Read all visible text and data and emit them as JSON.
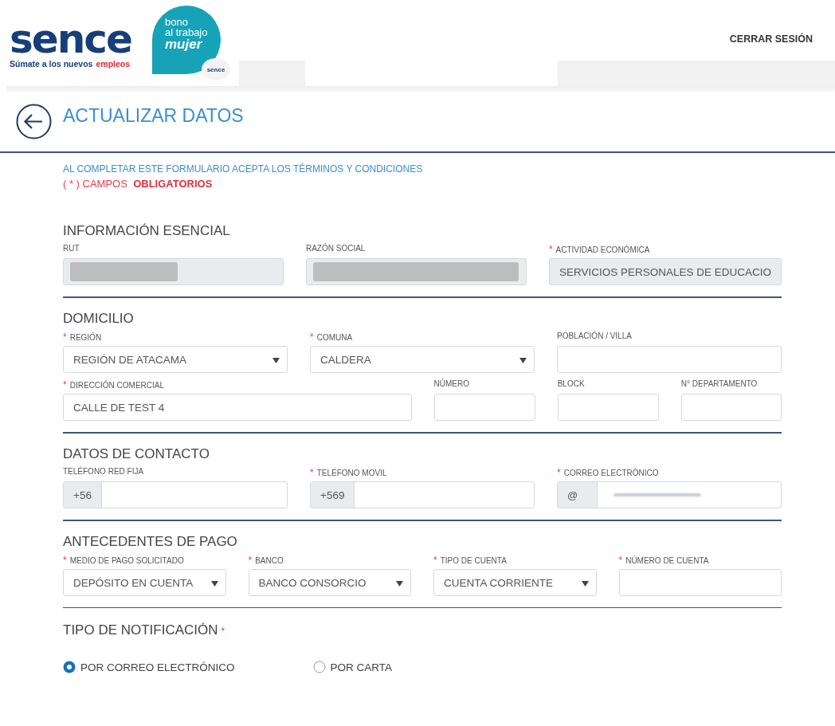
{
  "header": {
    "logo": {
      "wordmark": "sence",
      "tagline": "Súmate a los nuevos",
      "tagline_highlight": "empleos"
    },
    "badge": {
      "lines": [
        "bono",
        "al trabajo"
      ],
      "emphasis": "mujer",
      "mini_logo": "sence"
    },
    "logout": "CERRAR SESIÓN"
  },
  "page_title": "ACTUALIZAR DATOS",
  "notice": "AL COMPLETAR ESTE FORMULARIO ACEPTA LOS TÉRMINOS Y CONDICIONES",
  "required_note": "( * ) CAMPOS  **OBLIGATORIOS**",
  "sections": [
    {
      "title": "INFORMACIÓN ESENCIAL",
      "rows": [
        {
          "fields": [
            {
              "label": "RUT",
              "kind": "readonly",
              "redacted": true
            },
            {
              "label": "RAZÓN SOCIAL",
              "kind": "readonly",
              "redacted": true
            },
            {
              "label": "ACTIVIDAD ECONÓMICA",
              "mark": "*",
              "kind": "readonly",
              "value": "SERVICIOS PERSONALES DE EDUCACIO"
            }
          ]
        }
      ]
    },
    {
      "title": "DOMICILIO",
      "rows": [
        {
          "fields": [
            {
              "label": "REGIÓN",
              "mark": "*",
              "kind": "select",
              "value": "REGIÓN DE ATACAMA"
            },
            {
              "label": "COMUNA",
              "mark": "*",
              "kind": "select",
              "value": "CALDERA"
            },
            {
              "label": "POBLACIÓN / VILLA",
              "kind": "text"
            }
          ]
        },
        {
          "fields": [
            {
              "label": "DIRECCIÓN COMERCIAL",
              "mark": "*",
              "kind": "text",
              "value": "CALLE DE TEST 4"
            },
            {
              "label": "NÚMERO",
              "kind": "text"
            },
            {
              "label": "BLOCK",
              "kind": "text"
            },
            {
              "label": "N° DEPARTAMENTO",
              "kind": "text"
            }
          ]
        }
      ]
    },
    {
      "title": "DATOS DE CONTACTO",
      "rows": [
        {
          "fields": [
            {
              "label": "TELÉFONO RED FIJA",
              "kind": "prefixed",
              "prefix": "+56"
            },
            {
              "label": "TELÉFONO MOVIL",
              "mark": "*",
              "kind": "prefixed",
              "prefix": "+569"
            },
            {
              "label": "CORREO ELECTRÓNICO",
              "mark": "*",
              "kind": "prefixed",
              "prefix": "@",
              "redacted": true
            }
          ]
        }
      ]
    },
    {
      "title": "ANTECEDENTES DE PAGO",
      "rows": [
        {
          "fields": [
            {
              "label": "MEDIO DE PAGO SOLICITADO",
              "mark": "*",
              "kind": "select",
              "value": "DEPÓSITO EN CUENTA"
            },
            {
              "label": "BANCO",
              "mark": "*",
              "kind": "select",
              "value": "BANCO CONSORCIO"
            },
            {
              "label": "TIPO DE CUENTA",
              "mark": "*",
              "kind": "select",
              "value": "CUENTA CORRIENTE"
            },
            {
              "label": "NÚMERO DE CUENTA",
              "mark": "*",
              "kind": "text"
            }
          ]
        }
      ]
    }
  ],
  "notification": {
    "title": "TIPO DE NOTIFICACIÓN",
    "mark": "*",
    "options": [
      {
        "label": "POR CORREO ELECTRÓNICO",
        "selected": true
      },
      {
        "label": "POR CARTA",
        "selected": false
      }
    ]
  }
}
